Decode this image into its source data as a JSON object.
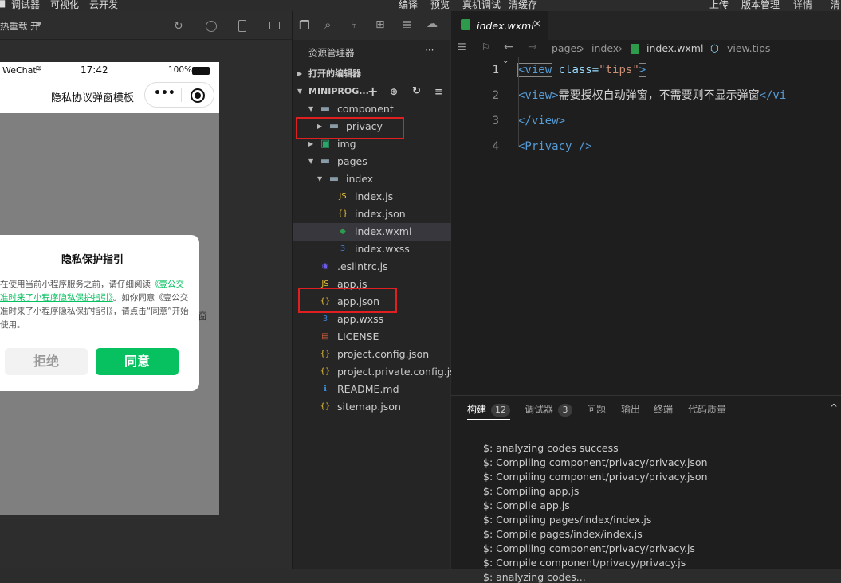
{
  "topmenu": {
    "left": [
      "调试器",
      "可视化",
      "云开发"
    ],
    "center": [
      "编译",
      "预览",
      "真机调试",
      "清缓存"
    ],
    "right": [
      "上传",
      "版本管理",
      "详情"
    ],
    "right_edge": "清"
  },
  "simulator": {
    "hot_reload": "热重载 开",
    "status": {
      "carrier": "WeChat",
      "time": "17:42",
      "battery": "100%"
    },
    "nav_title": "隐私协议弹窗模板",
    "capsule_more": "•••",
    "modal": {
      "title": "隐私保护指引",
      "body_pre": "在使用当前小程序服务之前，请仔细阅读",
      "body_link": "《壹公交准时来了小程序隐私保护指引》",
      "body_post": "。如你同意《壹公交准时来了小程序隐私保护指引》，请点击“同意”开始使用。",
      "reject": "拒绝",
      "agree": "同意"
    },
    "bg_char": "窗"
  },
  "explorer": {
    "title": "资源管理器",
    "more": "···",
    "open_editors": "打开的编辑器",
    "project": "MINIPROG...",
    "items": [
      {
        "label": "component",
        "icon": "folder-open-icon"
      },
      {
        "label": "privacy",
        "icon": "folder-icon"
      },
      {
        "label": "img",
        "icon": "image-folder-icon"
      },
      {
        "label": "pages",
        "icon": "folder-open-icon"
      },
      {
        "label": "index",
        "icon": "folder-open-icon"
      },
      {
        "label": "index.js",
        "icon": "js-icon"
      },
      {
        "label": "index.json",
        "icon": "json-icon"
      },
      {
        "label": "index.wxml",
        "icon": "wxml-icon"
      },
      {
        "label": "index.wxss",
        "icon": "css-icon"
      },
      {
        "label": ".eslintrc.js",
        "icon": "eslint-icon"
      },
      {
        "label": "app.js",
        "icon": "js-icon"
      },
      {
        "label": "app.json",
        "icon": "json-icon"
      },
      {
        "label": "app.wxss",
        "icon": "css-icon"
      },
      {
        "label": "LICENSE",
        "icon": "license-icon"
      },
      {
        "label": "project.config.json",
        "icon": "json-icon"
      },
      {
        "label": "project.private.config.js...",
        "icon": "json-icon"
      },
      {
        "label": "README.md",
        "icon": "info-icon"
      },
      {
        "label": "sitemap.json",
        "icon": "json-icon"
      }
    ]
  },
  "editor": {
    "tab": "index.wxml",
    "tab_close": "×",
    "breadcrumb": [
      "pages",
      "index",
      "index.wxml",
      "view.tips"
    ],
    "code": [
      {
        "num": "1",
        "parts": [
          [
            "tag",
            "<view"
          ],
          [
            "attr",
            " class="
          ],
          [
            "str",
            "\"tips\""
          ],
          [
            "tag",
            ">"
          ]
        ]
      },
      {
        "num": "2",
        "parts": [
          [
            "txt",
            "    "
          ],
          [
            "tag",
            "<view>"
          ],
          [
            "txt",
            "需要授权自动弹窗，不需要则不显示弹窗"
          ],
          [
            "tag",
            "</vi"
          ]
        ]
      },
      {
        "num": "3",
        "parts": [
          [
            "tag",
            "</view>"
          ]
        ]
      },
      {
        "num": "4",
        "parts": [
          [
            "tag",
            "<Privacy />"
          ]
        ]
      }
    ]
  },
  "panel": {
    "tabs": [
      {
        "label": "构建",
        "badge": "12"
      },
      {
        "label": "调试器",
        "badge": "3"
      },
      {
        "label": "问题",
        "badge": ""
      },
      {
        "label": "输出",
        "badge": ""
      },
      {
        "label": "终端",
        "badge": ""
      },
      {
        "label": "代码质量",
        "badge": ""
      }
    ],
    "logs": [
      "$: analyzing codes success",
      "$: Compiling component/privacy/privacy.json",
      "$: Compiling component/privacy/privacy.json",
      "$: Compiling app.js",
      "$: Compile app.js",
      "$: Compiling pages/index/index.js",
      "$: Compile pages/index/index.js",
      "$: Compiling component/privacy/privacy.js",
      "$: Compile component/privacy/privacy.js",
      "$: analyzing codes..."
    ]
  },
  "colors": {
    "accent_green": "#07c160",
    "highlight_red": "#e02020",
    "link_green": "#07c160"
  }
}
